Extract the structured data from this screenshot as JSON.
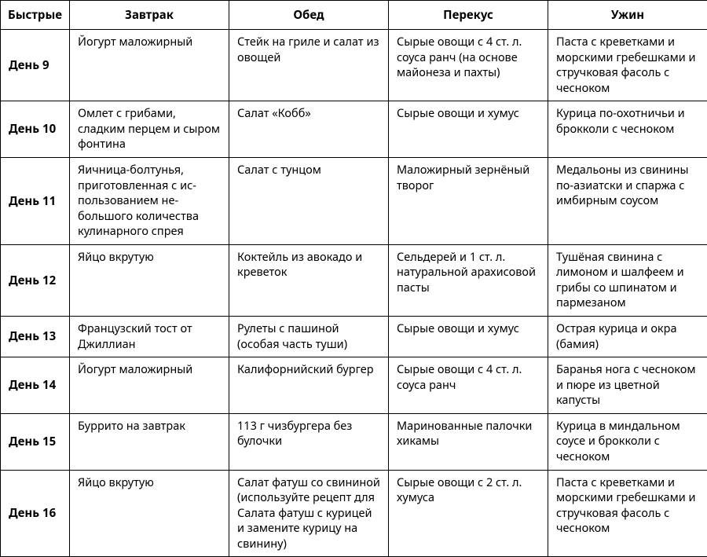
{
  "headers": {
    "c0": "Быстрые",
    "c1": "Завтрак",
    "c2": "Обед",
    "c3": "Перекус",
    "c4": "Ужин"
  },
  "rows": [
    {
      "day": "День 9",
      "breakfast": "Йогурт маложирный",
      "lunch": "Стейк на гриле и салат из овощей",
      "snack": "Сырые овощи с 4 ст. л. соуса ранч (на основе майонеза и пахты)",
      "dinner": "Паста с креветками и мор­скими гребешками и стручко­вая фасоль с чесноком"
    },
    {
      "day": "День 10",
      "breakfast": "Омлет с грибами, сладким перцем и сыром фонтина",
      "lunch": "Салат «Кобб»",
      "snack": "Сырые овощи и хумус",
      "dinner": "Курица по-охотничьи и брок­коли с чесноком"
    },
    {
      "day": "День 11",
      "breakfast": "Яичница-болтунья, приготовленная с ис­пользованием не­большого количества кулинарного спрея",
      "lunch": "Салат с тунцом",
      "snack": "Маложирный зернё­ный творог",
      "dinner": "Медальоны из свинины по-азиатски и спаржа с имбир­ным соусом"
    },
    {
      "day": "День 12",
      "breakfast": "Яйцо вкрутую",
      "lunch": "Коктейль из авокадо и креветок",
      "snack": "Сельдерей и 1 ст. л. натуральной арахисо­вой пасты",
      "dinner": "Тушёная свинина с лимоном и шалфеем и грибы со шпи­натом и пармезаном"
    },
    {
      "day": "День 13",
      "breakfast": "Французский тост от Джиллиан",
      "lunch": "Рулеты с пашиной (особая часть туши)",
      "snack": "Сырые овощи и хумус",
      "dinner": "Острая курица и окра (бамия)"
    },
    {
      "day": "День 14",
      "breakfast": "Йогурт маложирный",
      "lunch": "Калифорнийский бургер",
      "snack": "Сырые овощи с 4 ст. л. соуса ранч",
      "dinner": "Баранья нога с чесноком и пюре из цветной капусты"
    },
    {
      "day": "День 15",
      "breakfast": "Буррито на завтрак",
      "lunch": "113 г чизбургера без булочки",
      "snack": "Маринованные палоч­ки хикамы",
      "dinner": "Курица в миндальном соусе и брокколи с чесноком"
    },
    {
      "day": "День 16",
      "breakfast": "Яйцо вкрутую",
      "lunch": "Салат фатуш со свини­ной (используйте рецепт для Салата фатуш с ку­рицей и замените кури­цу на свинину)",
      "snack": "Сырые овощи с 2 ст. л. хумуса",
      "dinner": "Паста с креветками и мор­скими гребешками и стручко­вая фасоль с чесноком"
    }
  ]
}
